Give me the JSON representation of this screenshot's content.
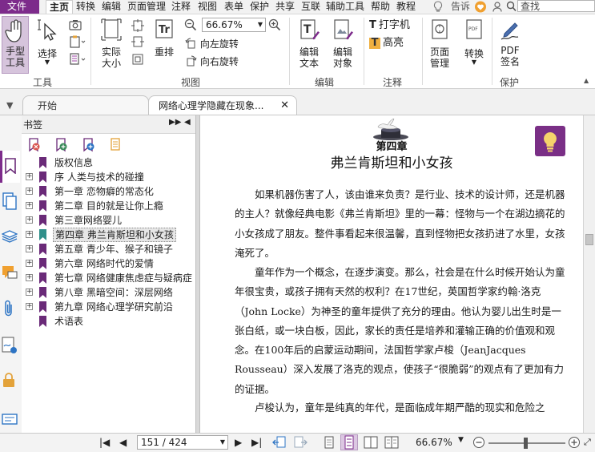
{
  "menu": {
    "file": "文件",
    "items": [
      "主页",
      "转换",
      "编辑",
      "页面管理",
      "注释",
      "视图",
      "表单",
      "保护",
      "共享",
      "互联",
      "辅助工具",
      "帮助",
      "教程"
    ],
    "tell": "告诉",
    "search_placeholder": "查找"
  },
  "ribbon": {
    "hand_tool": "手型\n工具",
    "hand_tool_l1": "手型",
    "hand_tool_l2": "工具",
    "select_l1": "选择",
    "actual_l1": "实际",
    "actual_l2": "大小",
    "reflow": "重排",
    "zoom_value": "66.67%",
    "rotate_left": "向左旋转",
    "rotate_right": "向右旋转",
    "edit_text_l1": "编辑",
    "edit_text_l2": "文本",
    "edit_obj_l1": "编辑",
    "edit_obj_l2": "对象",
    "typewriter": "打字机",
    "highlight": "高亮",
    "page_mgmt_l1": "页面",
    "page_mgmt_l2": "管理",
    "convert": "转换",
    "pdf_sign_l1": "PDF",
    "pdf_sign_l2": "签名",
    "groups": {
      "tools": "工具",
      "view": "视图",
      "edit": "编辑",
      "comment": "注释",
      "protect": "保护"
    }
  },
  "tabs": {
    "start": "开始",
    "document": "网络心理学隐藏在现象..."
  },
  "bookmarks": {
    "title": "书签",
    "items": [
      {
        "label": "版权信息",
        "expandable": false
      },
      {
        "label": "序 人类与技术的碰撞",
        "expandable": true
      },
      {
        "label": "第一章 恋物癖的常态化",
        "expandable": true
      },
      {
        "label": "第二章 目的就是让你上瘾",
        "expandable": true
      },
      {
        "label": "第三章网络婴儿",
        "expandable": true
      },
      {
        "label": "第四章 弗兰肯斯坦和小女孩",
        "expandable": true,
        "selected": true
      },
      {
        "label": "第五章 青少年、猴子和镜子",
        "expandable": true
      },
      {
        "label": "第六章 网络时代的爱情",
        "expandable": true
      },
      {
        "label": "第七章 网络健康焦虑症与疑病症",
        "expandable": true
      },
      {
        "label": "第八章 黑暗空间：深层网络",
        "expandable": true
      },
      {
        "label": "第九章 网络心理学研究前沿",
        "expandable": true
      },
      {
        "label": "术语表",
        "expandable": false
      }
    ]
  },
  "document": {
    "chapter_number": "第四章",
    "chapter_title": "弗兰肯斯坦和小女孩",
    "paragraphs": [
      "如果机器伤害了人，该由谁来负责？是行业、技术的设计师，还是机器的主人？就像经典电影《弗兰肯斯坦》里的一幕：怪物与一个在湖边摘花的小女孩成了朋友。整件事看起来很温馨，直到怪物把女孩扔进了水里，女孩淹死了。",
      "童年作为一个概念，在逐步演变。那么，社会是在什么时候开始认为童年很宝贵，或孩子拥有天然的权利？在17世纪，英国哲学家约翰·洛克（John Locke）为神圣的童年提供了充分的理由。他认为婴儿出生时是一张白纸，或一块白板，因此，家长的责任是培养和灌输正确的价值观和观念。在100年后的启蒙运动期间，法国哲学家卢梭（JeanJacques Rousseau）深入发展了洛克的观点，使孩子“很脆弱”的观点有了更加有力的证据。",
      "卢梭认为，童年是纯真的年代，是面临成年期严酷的现实和危险之"
    ]
  },
  "status": {
    "page_display": "151 / 424",
    "zoom": "66.67%"
  },
  "colors": {
    "accent": "#7d2b8b",
    "bookmark_flag": "#6a2a78",
    "selected_flag": "#2f8f8a",
    "lightbulb_bg": "#7a2f86"
  }
}
